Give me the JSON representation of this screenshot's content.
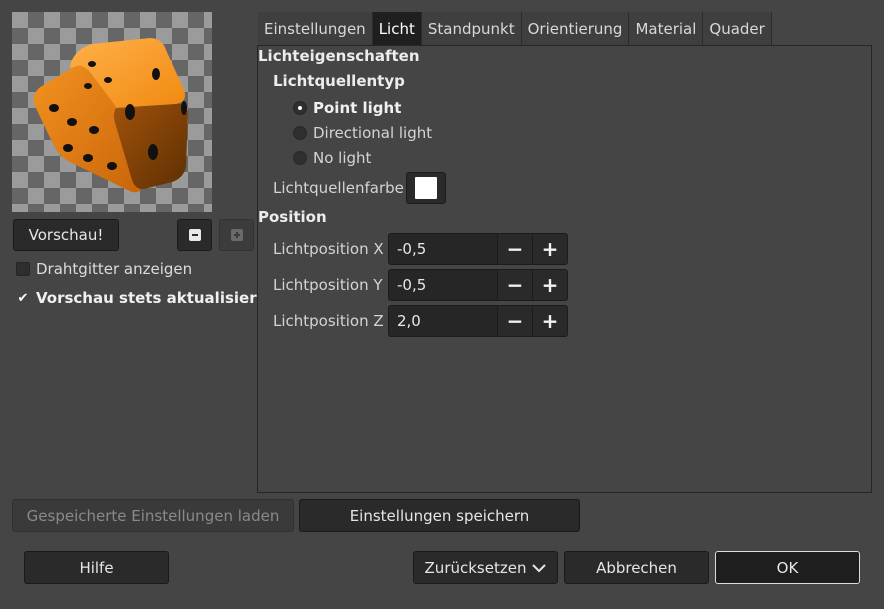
{
  "left": {
    "preview_button": "Vorschau!",
    "wireframe_label": "Drahtgitter anzeigen",
    "wireframe_checked": false,
    "auto_update_label": "Vorschau stets aktualisieren",
    "auto_update_checked": true
  },
  "tabs": [
    {
      "label": "Einstellungen",
      "active": false
    },
    {
      "label": "Licht",
      "active": true
    },
    {
      "label": "Standpunkt",
      "active": false
    },
    {
      "label": "Orientierung",
      "active": false
    },
    {
      "label": "Material",
      "active": false
    },
    {
      "label": "Quader",
      "active": false
    }
  ],
  "light": {
    "section_title": "Lichteigenschaften",
    "source_type_title": "Lichtquellentyp",
    "options": [
      {
        "label": "Point light",
        "selected": true
      },
      {
        "label": "Directional light",
        "selected": false
      },
      {
        "label": "No light",
        "selected": false
      }
    ],
    "color_label": "Lichtquellenfarbe",
    "color_value": "#ffffff",
    "position_title": "Position",
    "positions": [
      {
        "label": "Lichtposition X",
        "value": "-0,5"
      },
      {
        "label": "Lichtposition Y",
        "value": "-0,5"
      },
      {
        "label": "Lichtposition Z",
        "value": "2,0"
      }
    ]
  },
  "buttons": {
    "load_settings": "Gespeicherte Einstellungen laden",
    "save_settings": "Einstellungen speichern",
    "help": "Hilfe",
    "reset": "Zurücksetzen",
    "cancel": "Abbrechen",
    "ok": "OK"
  },
  "colors": {
    "dice_orange": "#f5961f",
    "dice_shadow": "#7a3e05",
    "pip": "#111111"
  }
}
